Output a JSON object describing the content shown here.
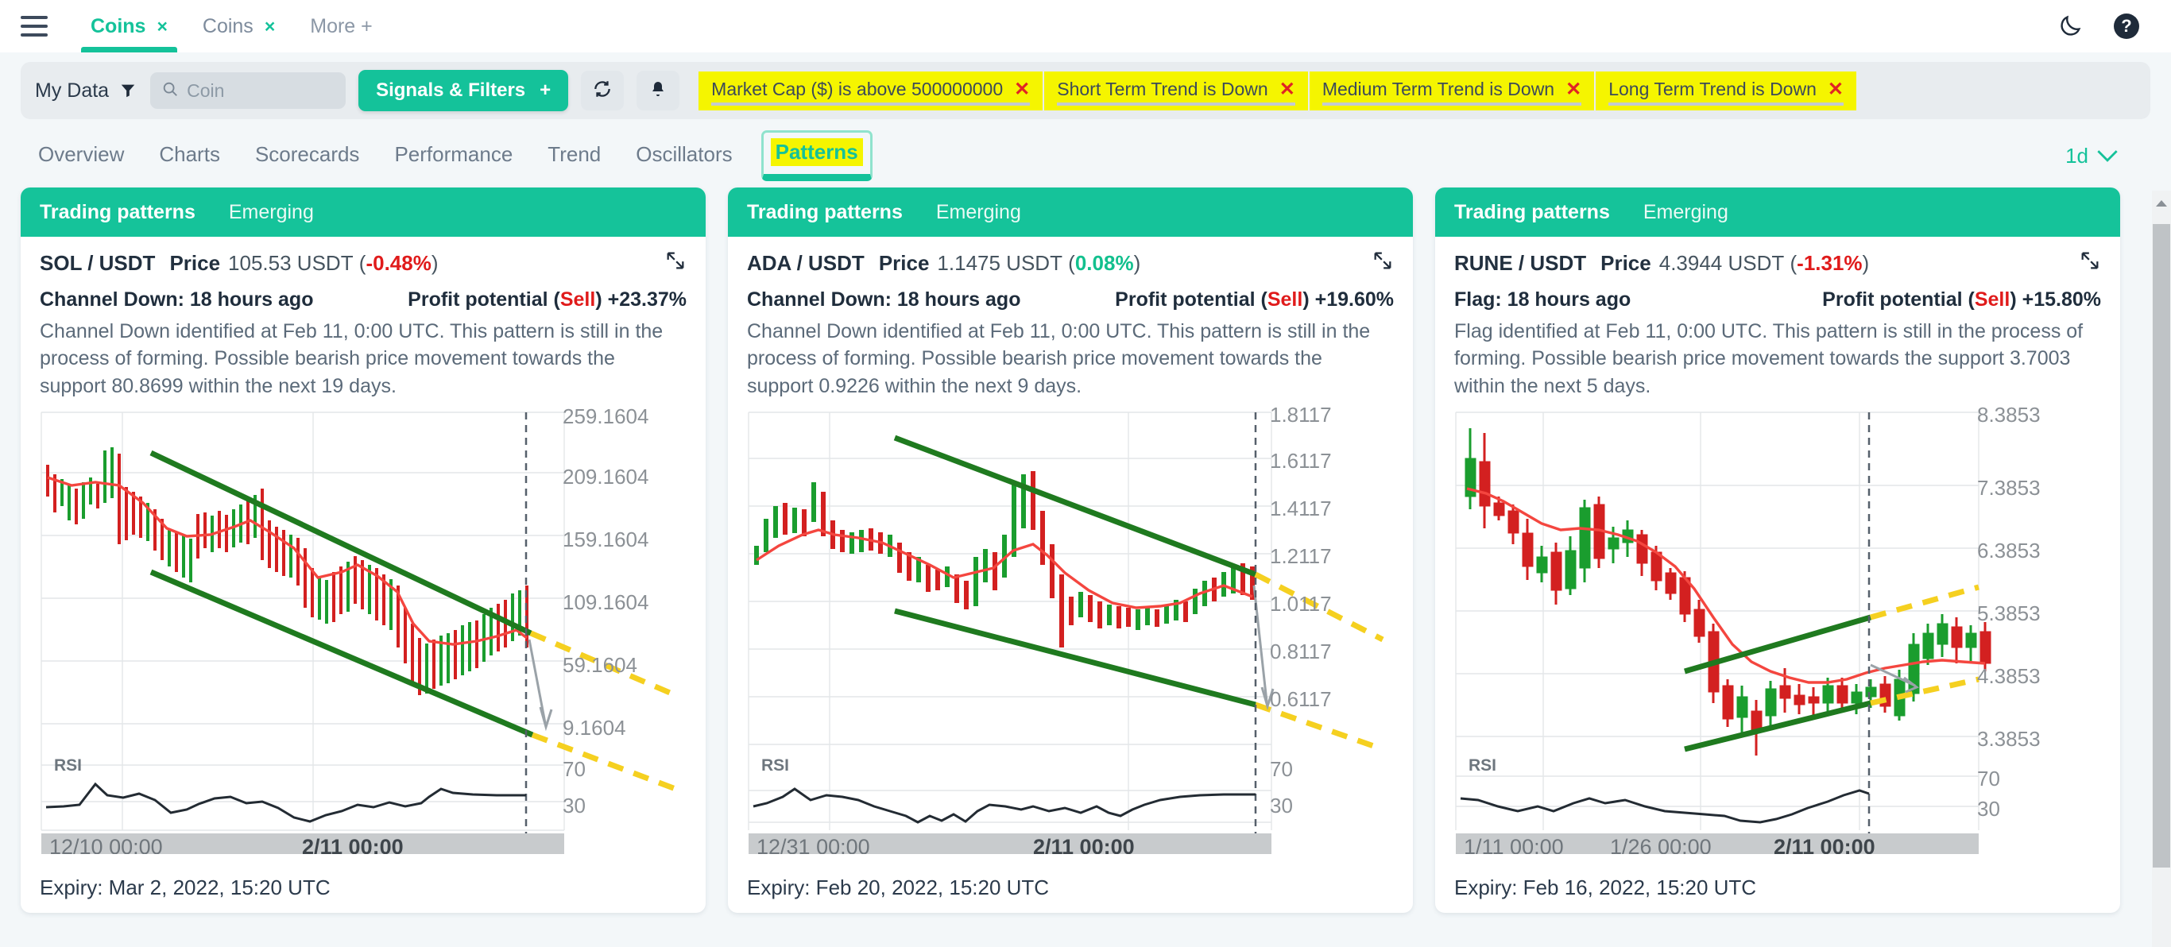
{
  "window": {
    "tabs": [
      {
        "label": "Coins",
        "close": "×",
        "active": true
      },
      {
        "label": "Coins",
        "close": "×",
        "active": false
      }
    ],
    "more_label": "More +",
    "theme_icon": "moon-icon",
    "help_icon": "help-circle-icon",
    "menu_icon": "hamburger-menu-icon"
  },
  "toolbar": {
    "my_data_label": "My Data",
    "filter_icon": "funnel-icon",
    "search_placeholder": "Coin",
    "search_value": "",
    "search_icon": "search-icon",
    "signals_button": "Signals & Filters",
    "signals_plus": "+",
    "refresh_icon": "refresh-icon",
    "bell_icon": "bell-icon",
    "chips": [
      {
        "label": "Market Cap ($) is above 500000000",
        "close": "✕"
      },
      {
        "label": "Short Term Trend is Down",
        "close": "✕"
      },
      {
        "label": "Medium Term Trend is Down",
        "close": "✕"
      },
      {
        "label": "Long Term Trend is Down",
        "close": "✕"
      }
    ]
  },
  "section_tabs": {
    "items": [
      "Overview",
      "Charts",
      "Scorecards",
      "Performance",
      "Trend",
      "Oscillators"
    ],
    "active": "Patterns",
    "period_label": "1d",
    "period_chevron": "chevron-down-icon"
  },
  "cards": [
    {
      "tab_primary": "Trading patterns",
      "tab_secondary": "Emerging",
      "pair": "SOL / USDT",
      "price_label": "Price",
      "price_value": "105.53 USDT",
      "change": "-0.48%",
      "change_dir": "neg",
      "expand_icon": "expand-icon",
      "pattern": "Channel Down: 18 hours ago",
      "profit_label": "Profit potential",
      "profit_action": "Sell",
      "profit_value": "+23.37%",
      "description": "Channel Down identified at Feb 11, 0:00 UTC. This pattern is still in the process of forming. Possible bearish price movement towards the support 80.8699 within the next 19 days.",
      "expiry": "Expiry: Mar 2, 2022, 15:20 UTC",
      "y_ticks": [
        "259.1604",
        "209.1604",
        "159.1604",
        "109.1604",
        "59.1604",
        "9.1604"
      ],
      "rsi_label": "RSI",
      "rsi_ticks": [
        "70",
        "30"
      ],
      "x_ticks": [
        "12/10 00:00",
        "2/11 00:00"
      ]
    },
    {
      "tab_primary": "Trading patterns",
      "tab_secondary": "Emerging",
      "pair": "ADA / USDT",
      "price_label": "Price",
      "price_value": "1.1475 USDT",
      "change": "0.08%",
      "change_dir": "pos",
      "expand_icon": "expand-icon",
      "pattern": "Channel Down: 18 hours ago",
      "profit_label": "Profit potential",
      "profit_action": "Sell",
      "profit_value": "+19.60%",
      "description": "Channel Down identified at Feb 11, 0:00 UTC. This pattern is still in the process of forming. Possible bearish price movement towards the support 0.9226 within the next 9 days.",
      "expiry": "Expiry: Feb 20, 2022, 15:20 UTC",
      "y_ticks": [
        "1.8117",
        "1.6117",
        "1.4117",
        "1.2117",
        "1.0117",
        "0.8117",
        "0.6117"
      ],
      "rsi_label": "RSI",
      "rsi_ticks": [
        "70",
        "30"
      ],
      "x_ticks": [
        "12/31 00:00",
        "2/11 00:00"
      ]
    },
    {
      "tab_primary": "Trading patterns",
      "tab_secondary": "Emerging",
      "pair": "RUNE / USDT",
      "price_label": "Price",
      "price_value": "4.3944 USDT",
      "change": "-1.31%",
      "change_dir": "neg",
      "expand_icon": "expand-icon",
      "pattern": "Flag: 18 hours ago",
      "profit_label": "Profit potential",
      "profit_action": "Sell",
      "profit_value": "+15.80%",
      "description": "Flag identified at Feb 11, 0:00 UTC. This pattern is still in the process of forming. Possible bearish price movement towards the support 3.7003 within the next 5 days.",
      "expiry": "Expiry: Feb 16, 2022, 15:20 UTC",
      "y_ticks": [
        "8.3853",
        "7.3853",
        "6.3853",
        "5.3853",
        "4.3853",
        "3.3853"
      ],
      "rsi_label": "RSI",
      "rsi_ticks": [
        "70",
        "30"
      ],
      "x_ticks": [
        "1/11 00:00",
        "1/26 00:00",
        "2/11 00:00"
      ]
    }
  ],
  "colors": {
    "accent": "#14c29a",
    "highlight": "#f5f500",
    "negative": "#e01b1b",
    "positive": "#12c08e",
    "bull_candle": "#1a9d2e",
    "bear_candle": "#d32020",
    "trendline": "#1f7a1f",
    "projection": "#f5d020",
    "ma_line": "#f4463f"
  },
  "chart_data": [
    {
      "type": "candlestick",
      "title": "SOL / USDT",
      "pattern": "Channel Down",
      "ylim": [
        9.1604,
        284.1604
      ],
      "y_ticks": [
        259.1604,
        209.1604,
        159.1604,
        109.1604,
        59.1604,
        9.1604
      ],
      "x_ticks": [
        "12/10 00:00",
        "2/11 00:00"
      ],
      "support_target": 80.8699,
      "current_price": 105.53,
      "rsi_bands": [
        70,
        30
      ],
      "overlays": [
        "moving-average",
        "channel-down-trendlines",
        "dashed-projection",
        "arrow-down",
        "current-time-marker"
      ]
    },
    {
      "type": "candlestick",
      "title": "ADA / USDT",
      "pattern": "Channel Down",
      "ylim": [
        0.5117,
        1.8617
      ],
      "y_ticks": [
        1.8117,
        1.6117,
        1.4117,
        1.2117,
        1.0117,
        0.8117,
        0.6117
      ],
      "x_ticks": [
        "12/31 00:00",
        "2/11 00:00"
      ],
      "support_target": 0.9226,
      "current_price": 1.1475,
      "rsi_bands": [
        70,
        30
      ],
      "overlays": [
        "moving-average",
        "channel-down-trendlines",
        "dashed-projection",
        "arrow-down",
        "current-time-marker"
      ]
    },
    {
      "type": "candlestick",
      "title": "RUNE / USDT",
      "pattern": "Flag",
      "ylim": [
        2.8853,
        8.8853
      ],
      "y_ticks": [
        8.3853,
        7.3853,
        6.3853,
        5.3853,
        4.3853,
        3.3853
      ],
      "x_ticks": [
        "1/11 00:00",
        "1/26 00:00",
        "2/11 00:00"
      ],
      "support_target": 3.7003,
      "current_price": 4.3944,
      "rsi_bands": [
        70,
        30
      ],
      "overlays": [
        "moving-average",
        "flag-trendlines",
        "dashed-projection",
        "arrow-down",
        "current-time-marker"
      ]
    }
  ]
}
